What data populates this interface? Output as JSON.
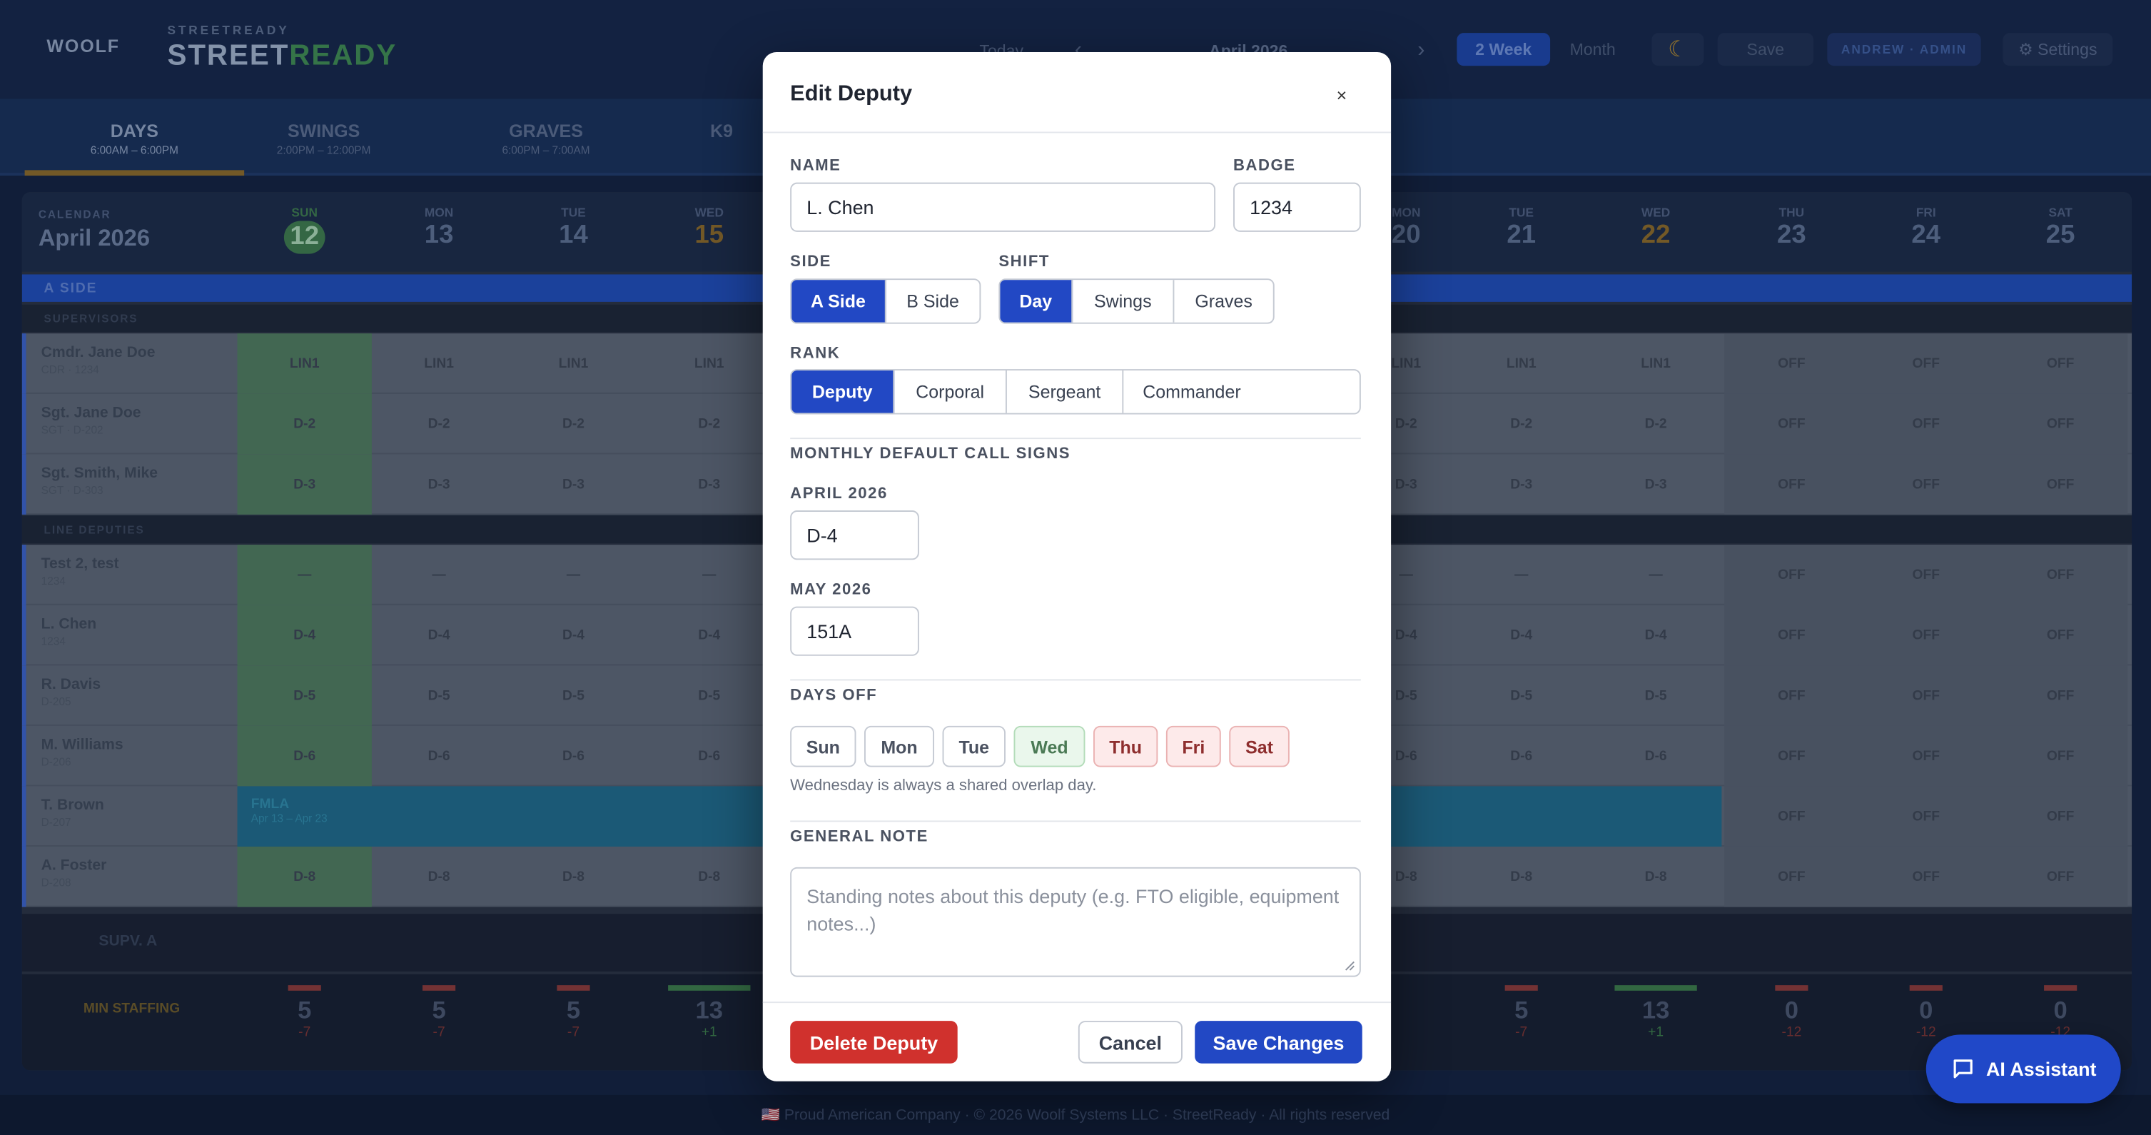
{
  "app": {
    "brand_top": "STREETREADY",
    "brand_a": "STREET",
    "brand_b": "READY",
    "logo": "WOOLF",
    "nav": {
      "today": "Today",
      "prev": "‹",
      "month_label": "April 2026",
      "next": "›",
      "view_2week": "2 Week",
      "view_month": "Month",
      "save": "Save",
      "user": "ANDREW · ADMIN",
      "settings": "⚙ Settings"
    },
    "shift_tabs": [
      {
        "label": "DAYS",
        "hours": "6:00AM – 6:00PM"
      },
      {
        "label": "SWINGS",
        "hours": "2:00PM – 12:00PM"
      },
      {
        "label": "GRAVES",
        "hours": "6:00PM – 7:00AM"
      },
      {
        "label": "K9",
        "hours": ""
      }
    ],
    "calendar": {
      "label": "CALENDAR",
      "month": "April 2026",
      "days_left": [
        {
          "dow": "SUN",
          "num": "12"
        },
        {
          "dow": "MON",
          "num": "13"
        },
        {
          "dow": "TUE",
          "num": "14"
        },
        {
          "dow": "WED",
          "num": "15"
        }
      ],
      "days_right": [
        {
          "dow": "MON",
          "num": "20"
        },
        {
          "dow": "TUE",
          "num": "21"
        },
        {
          "dow": "WED",
          "num": "22"
        },
        {
          "dow": "THU",
          "num": "23"
        },
        {
          "dow": "FRI",
          "num": "24"
        },
        {
          "dow": "SAT",
          "num": "25"
        }
      ]
    },
    "section_a": "A SIDE",
    "supervisors_label": "SUPERVISORS",
    "line_label": "LINE DEPUTIES",
    "rows": [
      {
        "name": "Cmdr. Jane Doe",
        "sub": "CDR · 1234",
        "code": "LIN1"
      },
      {
        "name": "Sgt. Jane Doe",
        "sub": "SGT · D-202",
        "code": "D-2"
      },
      {
        "name": "Sgt. Smith, Mike",
        "sub": "SGT · D-303",
        "code": "D-3"
      },
      {
        "name": "Test 2, test",
        "sub": "1234",
        "code": "—"
      },
      {
        "name": "L. Chen",
        "sub": "1234",
        "code": "D-4"
      },
      {
        "name": "R. Davis",
        "sub": "D-205",
        "code": "D-5"
      },
      {
        "name": "M. Williams",
        "sub": "D-206",
        "code": "D-6"
      },
      {
        "name": "T. Brown",
        "sub": "D-207",
        "code": "FMLA"
      },
      {
        "name": "A. Foster",
        "sub": "D-208",
        "code": "D-8"
      }
    ],
    "fmla_label": "FMLA",
    "fmla_range": "Apr 13 – Apr 23",
    "off_label": "OFF",
    "supv_row": "SUPV. A",
    "min_staffing": "MIN STAFFING",
    "staff_counts": [
      "5",
      "5",
      "5",
      "13",
      "5",
      "13",
      "0",
      "0",
      "0"
    ],
    "staff_deltas": [
      "-7",
      "-7",
      "-7",
      "+1",
      "-7",
      "+1",
      "-12",
      "-12",
      "-12"
    ],
    "footer": "🇺🇸 Proud American Company · © 2026 Woolf Systems LLC · StreetReady · All rights reserved",
    "ai_button": "AI Assistant"
  },
  "modal": {
    "title": "Edit Deputy",
    "close": "×",
    "name_label": "NAME",
    "name_value": "L. Chen",
    "badge_label": "BADGE",
    "badge_value": "1234",
    "side_label": "SIDE",
    "side_options": [
      "A Side",
      "B Side"
    ],
    "side_selected": "A Side",
    "shift_label": "SHIFT",
    "shift_options": [
      "Day",
      "Swings",
      "Graves"
    ],
    "shift_selected": "Day",
    "rank_label": "RANK",
    "rank_options": [
      "Deputy",
      "Corporal",
      "Sergeant",
      "Commander"
    ],
    "rank_selected": "Deputy",
    "call_signs_label": "MONTHLY DEFAULT CALL SIGNS",
    "april_label": "APRIL 2026",
    "april_value": "D-4",
    "may_label": "MAY 2026",
    "may_value": "151A",
    "days_off_label": "DAYS OFF",
    "days": [
      "Sun",
      "Mon",
      "Tue",
      "Wed",
      "Thu",
      "Fri",
      "Sat"
    ],
    "overlap_day": "Wed",
    "days_off_selected": [
      "Thu",
      "Fri",
      "Sat"
    ],
    "days_hint": "Wednesday is always a shared overlap day.",
    "note_label": "GENERAL NOTE",
    "note_placeholder": "Standing notes about this deputy (e.g. FTO eligible, equipment notes...)",
    "delete_label": "Delete Deputy",
    "cancel_label": "Cancel",
    "save_label": "Save Changes"
  }
}
